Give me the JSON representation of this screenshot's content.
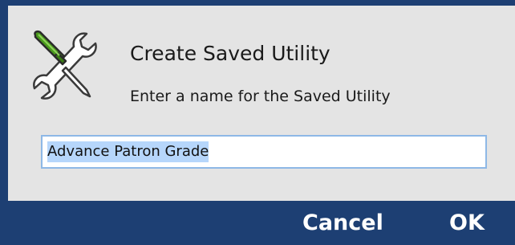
{
  "dialog": {
    "title": "Create Saved Utility",
    "prompt": "Enter a name for the Saved Utility",
    "icon": "tools-icon",
    "name_field": {
      "value": "Advance Patron Grade",
      "selected": true
    },
    "buttons": {
      "cancel_label": "Cancel",
      "ok_label": "OK"
    },
    "colors": {
      "frame": "#1d3f73",
      "background": "#e4e4e4",
      "selection": "#b6d6fb",
      "focus_border": "#8eb8e6",
      "screwdriver_handle": "#4a9a1c"
    }
  }
}
